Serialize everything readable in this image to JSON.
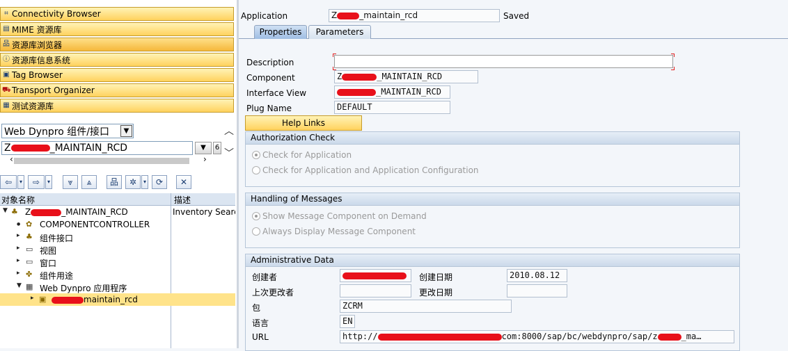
{
  "nav_buttons": [
    {
      "label": "Connectivity Browser",
      "icon": "connectivity-icon"
    },
    {
      "label": "MIME 资源库",
      "icon": "mime-icon"
    },
    {
      "label": "资源库浏览器",
      "icon": "repository-browser-icon"
    },
    {
      "label": "资源库信息系统",
      "icon": "repository-info-icon"
    },
    {
      "label": "Tag Browser",
      "icon": "tag-icon"
    },
    {
      "label": "Transport Organizer",
      "icon": "truck-icon"
    },
    {
      "label": "测试资源库",
      "icon": "test-repository-icon"
    }
  ],
  "object_type_select": {
    "value": "Web Dynpro 组件/接口"
  },
  "object_name_input": {
    "prefix": "Z",
    "suffix": "_MAINTAIN_RCD"
  },
  "tree": {
    "col_object": "对象名称",
    "col_desc": "描述",
    "root": {
      "name_prefix": "Z",
      "name_suffix": "_MAINTAIN_RCD",
      "desc": "Inventory Searc"
    },
    "items": [
      {
        "label": "COMPONENTCONTROLLER"
      },
      {
        "label": "组件接口"
      },
      {
        "label": "视图"
      },
      {
        "label": "窗口"
      },
      {
        "label": "组件用途"
      },
      {
        "label": "Web Dynpro 应用程序"
      }
    ],
    "selected": {
      "label_suffix": "maintain_rcd"
    }
  },
  "header": {
    "application_label": "Application",
    "application_prefix": "Z",
    "application_suffix": "_maintain_rcd",
    "status": "Saved"
  },
  "tabs": [
    {
      "label": "Properties",
      "active": true
    },
    {
      "label": "Parameters",
      "active": false
    }
  ],
  "properties": {
    "description_label": "Description",
    "description_value": "",
    "component_label": "Component",
    "component_prefix": "Z",
    "component_suffix": "_MAINTAIN_RCD",
    "interface_view_label": "Interface View",
    "interface_view_suffix": "_MAINTAIN_RCD",
    "plug_name_label": "Plug Name",
    "plug_name_value": "DEFAULT",
    "help_links_button": "Help Links"
  },
  "auth_check": {
    "title": "Authorization Check",
    "options": [
      {
        "label": "Check for Application",
        "selected": true
      },
      {
        "label": "Check for Application and Application Configuration",
        "selected": false
      }
    ]
  },
  "messages": {
    "title": "Handling of Messages",
    "options": [
      {
        "label": "Show Message Component on Demand",
        "selected": true
      },
      {
        "label": "Always Display Message Component",
        "selected": false
      }
    ]
  },
  "admin": {
    "title": "Administrative Data",
    "created_by_label": "创建者",
    "created_by_value": "",
    "created_on_label": "创建日期",
    "created_on_value": "2010.08.12",
    "last_changed_by_label": "上次更改者",
    "last_changed_by_value": "",
    "changed_on_label": "更改日期",
    "changed_on_value": "",
    "package_label": "包",
    "package_value": "ZCRM",
    "language_label": "语言",
    "language_value": "EN",
    "url_label": "URL",
    "url_prefix": "http://",
    "url_middle": "com:8000/sap/bc/webdynpro/sap/z",
    "url_suffix": "_ma…"
  },
  "colors": {
    "nav_button": "#ffd25e",
    "tab_active": "#9fbde3",
    "group_header": "#cbd9ea",
    "redaction": "#e8101a",
    "selected_row": "#ffe38a"
  }
}
